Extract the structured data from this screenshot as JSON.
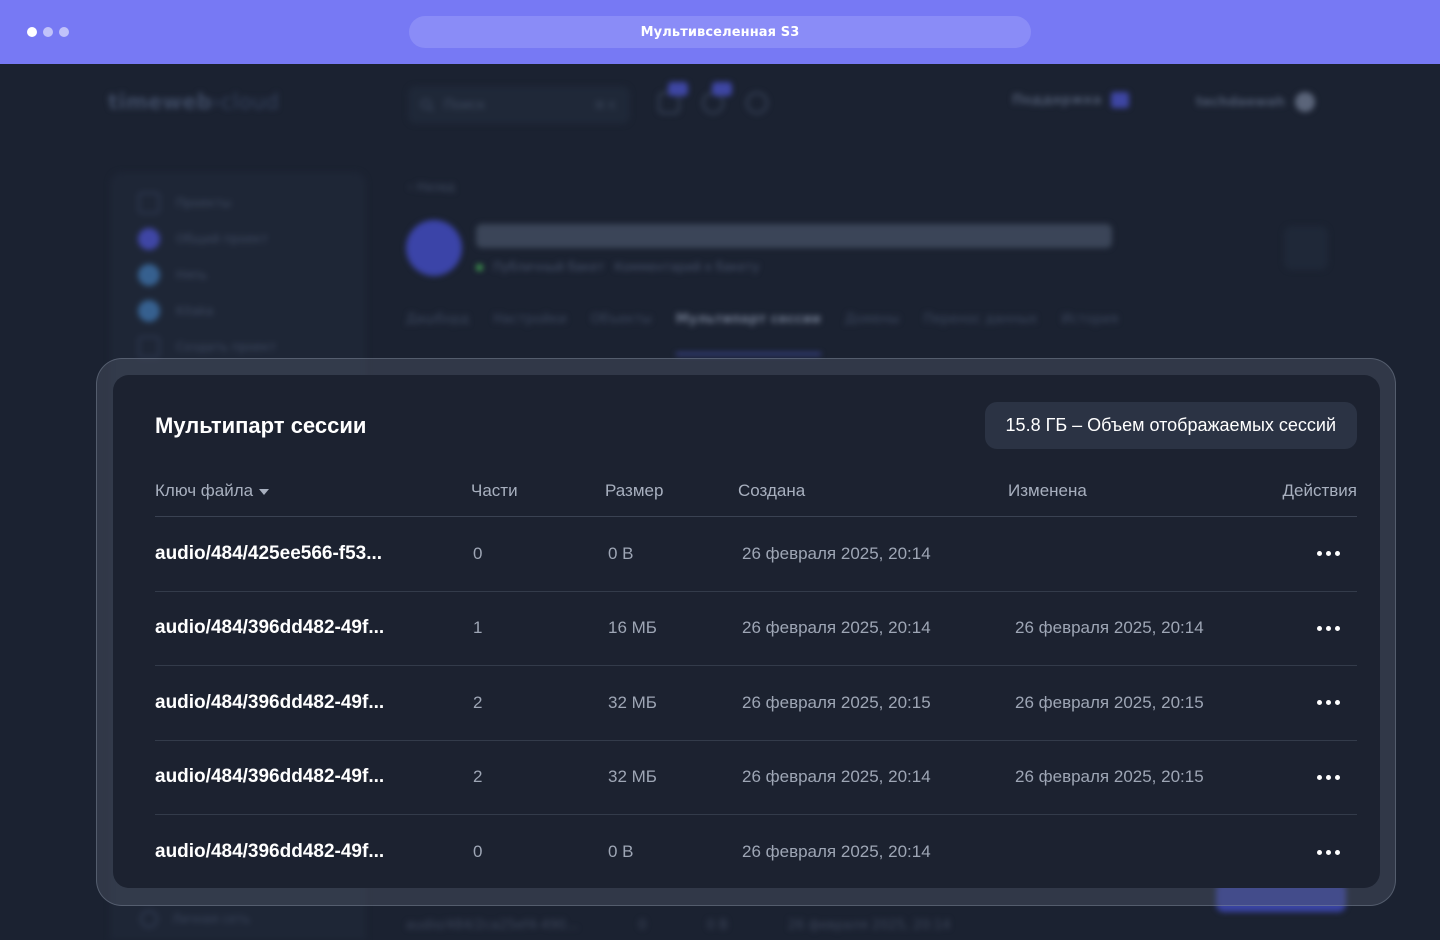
{
  "window": {
    "title": "Мультивселенная S3"
  },
  "modal": {
    "title": "Мультипарт сессии",
    "volume_label": "15.8 ГБ – Объем отображаемых сессий",
    "columns": {
      "key": "Ключ файла",
      "parts": "Части",
      "size": "Размер",
      "created": "Создана",
      "changed": "Изменена",
      "actions": "Действия"
    },
    "rows": [
      {
        "key": "audio/484/425ee566-f53...",
        "parts": "0",
        "size": "0 B",
        "created": "26 февраля 2025, 20:14",
        "changed": ""
      },
      {
        "key": "audio/484/396dd482-49f...",
        "parts": "1",
        "size": "16 МБ",
        "created": "26 февраля 2025, 20:14",
        "changed": "26 февраля 2025, 20:14"
      },
      {
        "key": "audio/484/396dd482-49f...",
        "parts": "2",
        "size": "32 МБ",
        "created": "26 февраля 2025, 20:15",
        "changed": "26 февраля 2025, 20:15"
      },
      {
        "key": "audio/484/396dd482-49f...",
        "parts": "2",
        "size": "32 МБ",
        "created": "26 февраля 2025, 20:14",
        "changed": "26 февраля 2025, 20:15"
      },
      {
        "key": "audio/484/396dd482-49f...",
        "parts": "0",
        "size": "0 B",
        "created": "26 февраля 2025, 20:14",
        "changed": ""
      }
    ]
  },
  "background": {
    "logo_main": "timeweb",
    "logo_sub": "›cloud",
    "search_placeholder": "Поиск",
    "search_shortcut": "⌘ K",
    "support_label": "Поддержка",
    "user_name": "techdaewah",
    "breadcrumb": "‹ Назад",
    "bucket_status": "Публичный бакет",
    "bucket_comment": "Комментарий к бакету",
    "tabs": [
      "Дашборд",
      "Настройки",
      "Объекты",
      "Мультипарт сессии",
      "Домены",
      "Перенос данных",
      "История"
    ],
    "active_tab": "Мультипарт сессии",
    "sidebar_items": [
      "Проекты",
      "Общий проект",
      "Няпь",
      "Kitaka",
      "Создать проект"
    ],
    "sidebar_bottom": "Личная сеть",
    "ghost_row": [
      "audio/484/2ca25ef4-490...",
      "0",
      "0 B",
      "26 февраля 2025, 20:14"
    ]
  },
  "colors": {
    "topbar": "#7779f4",
    "panel_bg": "#1c2230",
    "chip_bg": "#2b3344",
    "page_bg": "#1b2231"
  }
}
